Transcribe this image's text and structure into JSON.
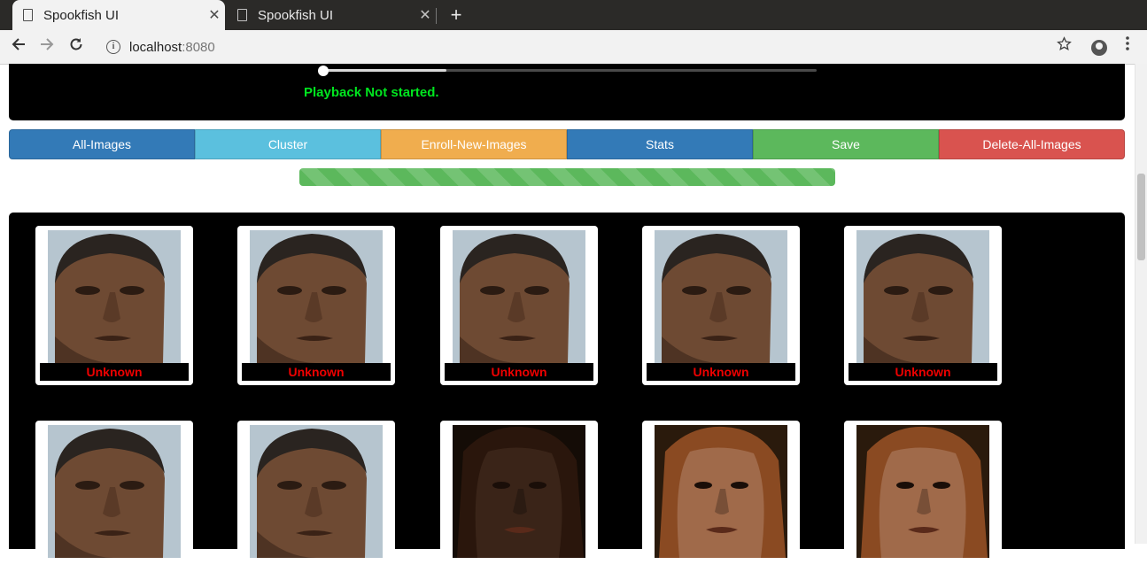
{
  "browser": {
    "tabs": [
      {
        "title": "Spookfish UI",
        "close": "✕"
      },
      {
        "title": "Spookfish UI",
        "close": "✕"
      }
    ],
    "new_tab": "+",
    "url_host": "localhost",
    "url_port": ":8080"
  },
  "player": {
    "progress_fraction": 0.25,
    "status": "Playback Not started."
  },
  "toolbar": {
    "buttons": [
      {
        "label": "All-Images",
        "color": "#337ab7"
      },
      {
        "label": "Cluster",
        "color": "#5bc0de"
      },
      {
        "label": "Enroll-New-Images",
        "color": "#f0ad4e"
      },
      {
        "label": "Stats",
        "color": "#337ab7"
      },
      {
        "label": "Save",
        "color": "#5cb85c"
      },
      {
        "label": "Delete-All-Images",
        "color": "#d9534f"
      }
    ]
  },
  "progress": {
    "value": 1.0,
    "color": "#5cb85c"
  },
  "gallery": {
    "items": [
      {
        "kind": "male-face",
        "label": "Unknown"
      },
      {
        "kind": "male-face",
        "label": "Unknown"
      },
      {
        "kind": "male-face",
        "label": "Unknown"
      },
      {
        "kind": "male-face",
        "label": "Unknown"
      },
      {
        "kind": "male-face",
        "label": "Unknown"
      },
      {
        "kind": "male-face",
        "label": ""
      },
      {
        "kind": "male-face",
        "label": ""
      },
      {
        "kind": "female-face-dark",
        "label": ""
      },
      {
        "kind": "female-face",
        "label": ""
      },
      {
        "kind": "female-face",
        "label": ""
      }
    ]
  }
}
